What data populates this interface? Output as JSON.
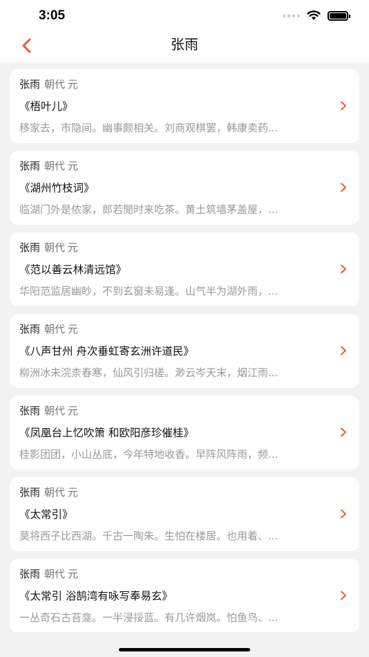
{
  "status": {
    "time": "3:05",
    "icons": [
      "signal-dots-icon",
      "wifi-icon",
      "battery-icon"
    ]
  },
  "nav": {
    "title": "张雨",
    "back_icon": "chevron-left-icon",
    "accent_color": "#f05a28"
  },
  "poems": [
    {
      "author": "张雨",
      "dynasty_label": "朝代",
      "dynasty": "元",
      "title": "《梧叶儿》",
      "excerpt": "移家去，市隐间。幽事颇相关。刘商观棋罢，韩康卖药..."
    },
    {
      "author": "张雨",
      "dynasty_label": "朝代",
      "dynasty": "元",
      "title": "《湖州竹枝词》",
      "excerpt": "临湖门外是侬家，郎若閒时来吃茶。黄土筑墙茅盖屋，..."
    },
    {
      "author": "张雨",
      "dynasty_label": "朝代",
      "dynasty": "元",
      "title": "《范以善云林清远馆》",
      "excerpt": "华阳范监居幽眇，不到玄窗未易逢。山气半为湖外雨，..."
    },
    {
      "author": "张雨",
      "dynasty_label": "朝代",
      "dynasty": "元",
      "title": "《八声甘州 舟次垂虹寄玄洲许道民》",
      "excerpt": "柳洲冰未浣柰春寒，仙风引归槎。渺云岑天末，烟江雨..."
    },
    {
      "author": "张雨",
      "dynasty_label": "朝代",
      "dynasty": "元",
      "title": "《凤凰台上忆吹箫 和欧阳彦珍催桂》",
      "excerpt": "桂影团团，小山丛底，今年特地收香。早阵风阵雨，频..."
    },
    {
      "author": "张雨",
      "dynasty_label": "朝代",
      "dynasty": "元",
      "title": "《太常引》",
      "excerpt": "莫将西子比西湖。千古一陶朱。生怕在楼居。也用着、..."
    },
    {
      "author": "张雨",
      "dynasty_label": "朝代",
      "dynasty": "元",
      "title": "《太常引 浴鹄湾有咏写奉易玄》",
      "excerpt": "一丛奇石古苔龛。一半浸挼蓝。有几许烟岚。怕鱼鸟、..."
    }
  ]
}
